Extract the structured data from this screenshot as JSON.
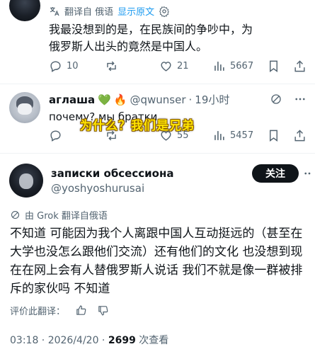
{
  "post1": {
    "translate_label": "翻译自 俄语",
    "show_original_label": "显示原文",
    "translated_text": "我最没想到的是，在民族间的争吵中，为俄罗斯人出头的竟然是中国人。",
    "reply_count": "10",
    "like_count": "21",
    "view_count": "5667"
  },
  "post2": {
    "display_name": "аглаша",
    "handle": "@qwunser",
    "time": "19小时",
    "text": "почему? мы братки",
    "like_count": "55",
    "view_count": "5457",
    "caption": "为什么？我们是兄弟"
  },
  "post3": {
    "display_name": "записки обсессиона",
    "handle": "@yoshyoshurusai",
    "follow_label": "关注",
    "grok_label": "由 Grok 翻译自俄语",
    "translated_text": "不知道 可能因为我个人离跟中国人互动挺远的（甚至在大学也没怎么跟他们交流）还有他们的文化 也没想到现在在网上会有人替俄罗斯人说话 我们不就是像一群被排斥的家伙吗 不知道",
    "rate_label": "评价此翻译：",
    "timestamp": "03:18 · 2026/4/20 · ",
    "view_count": "2699",
    "view_label": " 次查看"
  },
  "icons": {
    "emoji_heart": "💚",
    "emoji_fire": "🔥"
  },
  "colors": {
    "accent": "#1d9bf0",
    "text": "#0f1419",
    "muted": "#536471",
    "divider": "#eff3f4"
  }
}
